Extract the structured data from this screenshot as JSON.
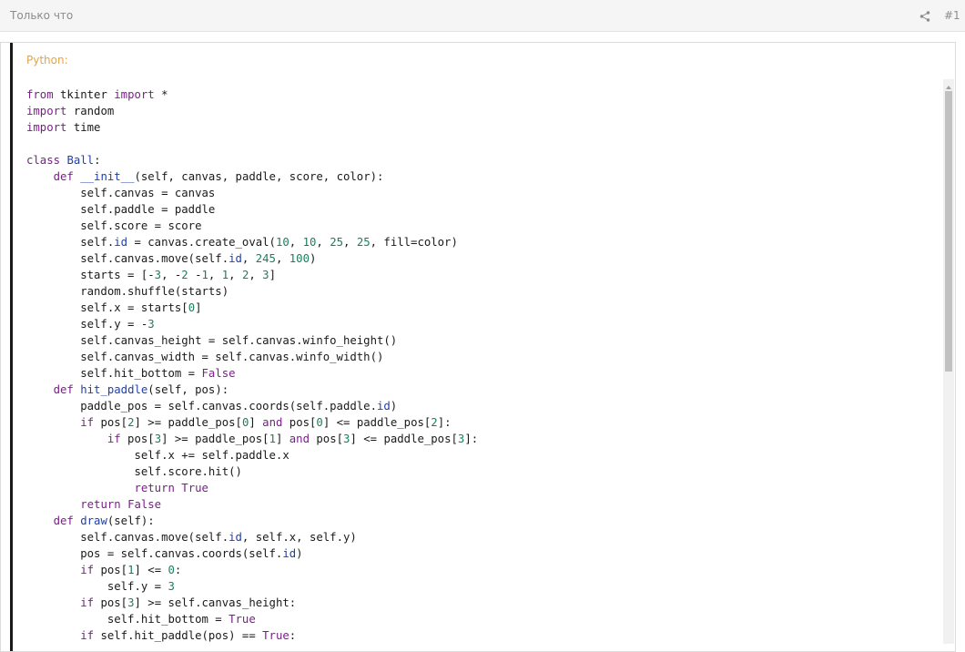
{
  "header": {
    "time_text": "Только что",
    "post_number": "#1",
    "share_icon": "share-icon"
  },
  "code_block": {
    "language_label": "Python:",
    "lines": [
      [
        {
          "t": "from",
          "c": "kw"
        },
        {
          "t": " tkinter "
        },
        {
          "t": "import",
          "c": "kw"
        },
        {
          "t": " *"
        }
      ],
      [
        {
          "t": "import",
          "c": "kw"
        },
        {
          "t": " random"
        }
      ],
      [
        {
          "t": "import",
          "c": "kw"
        },
        {
          "t": " time"
        }
      ],
      [],
      [
        {
          "t": "class",
          "c": "kw"
        },
        {
          "t": " "
        },
        {
          "t": "Ball",
          "c": "fn"
        },
        {
          "t": ":"
        }
      ],
      [
        {
          "t": "    "
        },
        {
          "t": "def",
          "c": "kw"
        },
        {
          "t": " "
        },
        {
          "t": "__init__",
          "c": "fn"
        },
        {
          "t": "(self, canvas, paddle, score, color):"
        }
      ],
      [
        {
          "t": "        self.canvas = canvas"
        }
      ],
      [
        {
          "t": "        self.paddle = paddle"
        }
      ],
      [
        {
          "t": "        self.score = score"
        }
      ],
      [
        {
          "t": "        self."
        },
        {
          "t": "id",
          "c": "fn"
        },
        {
          "t": " = canvas.create_oval("
        },
        {
          "t": "10",
          "c": "num"
        },
        {
          "t": ", "
        },
        {
          "t": "10",
          "c": "num"
        },
        {
          "t": ", "
        },
        {
          "t": "25",
          "c": "num"
        },
        {
          "t": ", "
        },
        {
          "t": "25",
          "c": "num"
        },
        {
          "t": ", fill=color)"
        }
      ],
      [
        {
          "t": "        self.canvas.move(self."
        },
        {
          "t": "id",
          "c": "fn"
        },
        {
          "t": ", "
        },
        {
          "t": "245",
          "c": "num"
        },
        {
          "t": ", "
        },
        {
          "t": "100",
          "c": "num"
        },
        {
          "t": ")"
        }
      ],
      [
        {
          "t": "        starts = [-"
        },
        {
          "t": "3",
          "c": "num"
        },
        {
          "t": ", -"
        },
        {
          "t": "2",
          "c": "num"
        },
        {
          "t": " -"
        },
        {
          "t": "1",
          "c": "num"
        },
        {
          "t": ", "
        },
        {
          "t": "1",
          "c": "num"
        },
        {
          "t": ", "
        },
        {
          "t": "2",
          "c": "num"
        },
        {
          "t": ", "
        },
        {
          "t": "3",
          "c": "num"
        },
        {
          "t": "]"
        }
      ],
      [
        {
          "t": "        random.shuffle(starts)"
        }
      ],
      [
        {
          "t": "        self.x = starts["
        },
        {
          "t": "0",
          "c": "num"
        },
        {
          "t": "]"
        }
      ],
      [
        {
          "t": "        self.y = -"
        },
        {
          "t": "3",
          "c": "num"
        }
      ],
      [
        {
          "t": "        self.canvas_height = self.canvas.winfo_height()"
        }
      ],
      [
        {
          "t": "        self.canvas_width = self.canvas.winfo_width()"
        }
      ],
      [
        {
          "t": "        self.hit_bottom = "
        },
        {
          "t": "False",
          "c": "con"
        }
      ],
      [
        {
          "t": "    "
        },
        {
          "t": "def",
          "c": "kw"
        },
        {
          "t": " "
        },
        {
          "t": "hit_paddle",
          "c": "fn"
        },
        {
          "t": "(self, pos):"
        }
      ],
      [
        {
          "t": "        paddle_pos = self.canvas.coords(self.paddle."
        },
        {
          "t": "id",
          "c": "fn"
        },
        {
          "t": ")"
        }
      ],
      [
        {
          "t": "        "
        },
        {
          "t": "if",
          "c": "kw"
        },
        {
          "t": " pos["
        },
        {
          "t": "2",
          "c": "num"
        },
        {
          "t": "] >= paddle_pos["
        },
        {
          "t": "0",
          "c": "num"
        },
        {
          "t": "] "
        },
        {
          "t": "and",
          "c": "kw"
        },
        {
          "t": " pos["
        },
        {
          "t": "0",
          "c": "num"
        },
        {
          "t": "] <= paddle_pos["
        },
        {
          "t": "2",
          "c": "num"
        },
        {
          "t": "]:"
        }
      ],
      [
        {
          "t": "            "
        },
        {
          "t": "if",
          "c": "kw"
        },
        {
          "t": " pos["
        },
        {
          "t": "3",
          "c": "num"
        },
        {
          "t": "] >= paddle_pos["
        },
        {
          "t": "1",
          "c": "num"
        },
        {
          "t": "] "
        },
        {
          "t": "and",
          "c": "kw"
        },
        {
          "t": " pos["
        },
        {
          "t": "3",
          "c": "num"
        },
        {
          "t": "] <= paddle_pos["
        },
        {
          "t": "3",
          "c": "num"
        },
        {
          "t": "]:"
        }
      ],
      [
        {
          "t": "                self.x += self.paddle.x"
        }
      ],
      [
        {
          "t": "                self.score.hit()"
        }
      ],
      [
        {
          "t": "                "
        },
        {
          "t": "return",
          "c": "kw"
        },
        {
          "t": " "
        },
        {
          "t": "True",
          "c": "con"
        }
      ],
      [
        {
          "t": "        "
        },
        {
          "t": "return",
          "c": "kw"
        },
        {
          "t": " "
        },
        {
          "t": "False",
          "c": "con"
        }
      ],
      [
        {
          "t": "    "
        },
        {
          "t": "def",
          "c": "kw"
        },
        {
          "t": " "
        },
        {
          "t": "draw",
          "c": "fn"
        },
        {
          "t": "(self):"
        }
      ],
      [
        {
          "t": "        self.canvas.move(self."
        },
        {
          "t": "id",
          "c": "fn"
        },
        {
          "t": ", self.x, self.y)"
        }
      ],
      [
        {
          "t": "        pos = self.canvas.coords(self."
        },
        {
          "t": "id",
          "c": "fn"
        },
        {
          "t": ")"
        }
      ],
      [
        {
          "t": "        "
        },
        {
          "t": "if",
          "c": "kw"
        },
        {
          "t": " pos["
        },
        {
          "t": "1",
          "c": "num"
        },
        {
          "t": "] <= "
        },
        {
          "t": "0",
          "c": "num"
        },
        {
          "t": ":"
        }
      ],
      [
        {
          "t": "            self.y = "
        },
        {
          "t": "3",
          "c": "num"
        }
      ],
      [
        {
          "t": "        "
        },
        {
          "t": "if",
          "c": "kw"
        },
        {
          "t": " pos["
        },
        {
          "t": "3",
          "c": "num"
        },
        {
          "t": "] >= self.canvas_height:"
        }
      ],
      [
        {
          "t": "            self.hit_bottom = "
        },
        {
          "t": "True",
          "c": "con"
        }
      ],
      [
        {
          "t": "        "
        },
        {
          "t": "if",
          "c": "kw"
        },
        {
          "t": " self.hit_paddle(pos) == "
        },
        {
          "t": "True",
          "c": "con"
        },
        {
          "t": ":"
        }
      ]
    ]
  },
  "colors": {
    "header_bg": "#f5f5f5",
    "language_label": "#e8a33d",
    "keyword": "#7d1d8c",
    "function_name": "#1d3fb0",
    "number": "#19805a",
    "left_bar": "#1a1a1a"
  },
  "scrollbar": {
    "position_fraction": 0.0
  }
}
